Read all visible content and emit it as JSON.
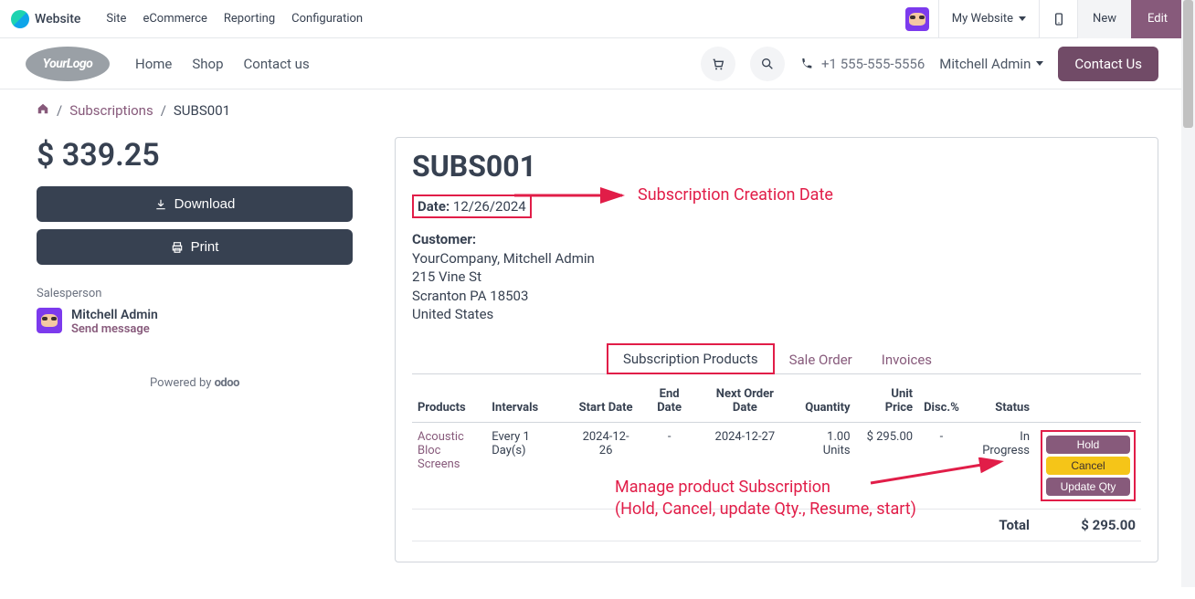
{
  "appbar": {
    "app_name": "Website",
    "menu": [
      "Site",
      "eCommerce",
      "Reporting",
      "Configuration"
    ],
    "site_dropdown": "My Website",
    "new_btn": "New",
    "edit_btn": "Edit"
  },
  "site_header": {
    "logo_text": "YourLogo",
    "nav": [
      "Home",
      "Shop",
      "Contact us"
    ],
    "phone": "+1 555-555-5556",
    "user": "Mitchell Admin",
    "contact_btn": "Contact Us"
  },
  "breadcrumb": {
    "items": [
      "Subscriptions",
      "SUBS001"
    ]
  },
  "left": {
    "price": "$ 339.25",
    "download": "Download",
    "print": "Print",
    "salesperson_label": "Salesperson",
    "salesperson_name": "Mitchell Admin",
    "send_message": "Send message",
    "powered_prefix": "Powered by ",
    "powered_brand": "odoo"
  },
  "detail": {
    "title": "SUBS001",
    "date_label": "Date:",
    "date_value": "12/26/2024",
    "customer_label": "Customer:",
    "customer_lines": [
      "YourCompany, Mitchell Admin",
      "215 Vine St",
      "Scranton PA 18503",
      "United States"
    ],
    "tabs": [
      "Subscription Products",
      "Sale Order",
      "Invoices"
    ],
    "columns": [
      "Products",
      "Intervals",
      "Start Date",
      "End Date",
      "Next Order Date",
      "Quantity",
      "Unit Price",
      "Disc.%",
      "Status"
    ],
    "row": {
      "product": "Acoustic Bloc Screens",
      "interval": "Every 1 Day(s)",
      "start": "2024-12-26",
      "end": "-",
      "next": "2024-12-27",
      "qty": "1.00 Units",
      "price": "$ 295.00",
      "disc": "-",
      "status": "In Progress",
      "actions": {
        "hold": "Hold",
        "cancel": "Cancel",
        "update": "Update Qty"
      }
    },
    "total_label": "Total",
    "total_value": "$ 295.00"
  },
  "annotations": {
    "creation": "Subscription Creation Date",
    "manage1": "Manage product Subscription",
    "manage2": "(Hold, Cancel, update Qty., Resume, start)"
  }
}
